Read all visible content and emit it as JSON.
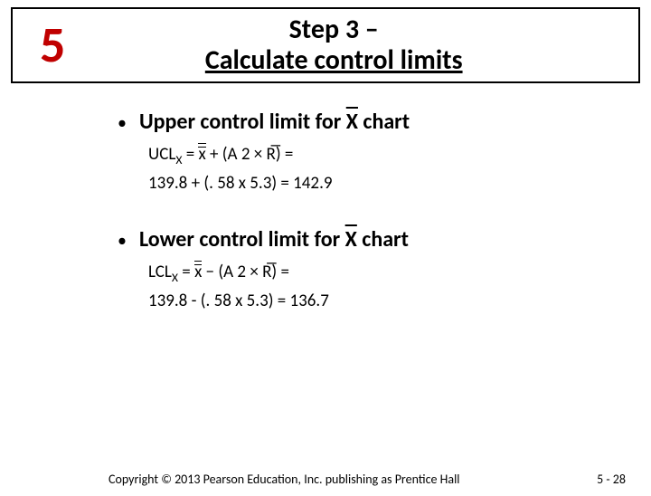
{
  "title": {
    "number": "5",
    "line1": "Step 3 –",
    "line2": "Calculate control limits"
  },
  "upper": {
    "heading_prefix": "Upper control limit for ",
    "heading_symbol": "X",
    "heading_suffix": " chart",
    "lhs": "UCL",
    "lhs_sub": "X",
    "rhs_symbolic": " + (A 2  × R̅) =",
    "numeric": "139.8 + (. 58 x 5.3) = 142.9"
  },
  "lower": {
    "heading_prefix": "Lower control limit for ",
    "heading_symbol": "X",
    "heading_suffix": " chart",
    "lhs": "LCL",
    "lhs_sub": "X",
    "rhs_symbolic": " − (A 2  × R̅) =",
    "numeric": "139.8 - (. 58 x 5.3) = 136.7"
  },
  "footer": {
    "copyright": "Copyright © 2013 Pearson Education, Inc. publishing as Prentice Hall",
    "page": "5 - 28"
  },
  "chart_data": {
    "type": "table",
    "title": "Step 3 – Calculate control limits (X̄ chart)",
    "rows": [
      {
        "limit": "UCLx",
        "formula": "x-double-bar + (A2 × R-bar)",
        "x_double_bar": 139.8,
        "A2": 0.58,
        "R_bar": 5.3,
        "result": 142.9
      },
      {
        "limit": "LCLx",
        "formula": "x-double-bar − (A2 × R-bar)",
        "x_double_bar": 139.8,
        "A2": 0.58,
        "R_bar": 5.3,
        "result": 136.7
      }
    ]
  }
}
